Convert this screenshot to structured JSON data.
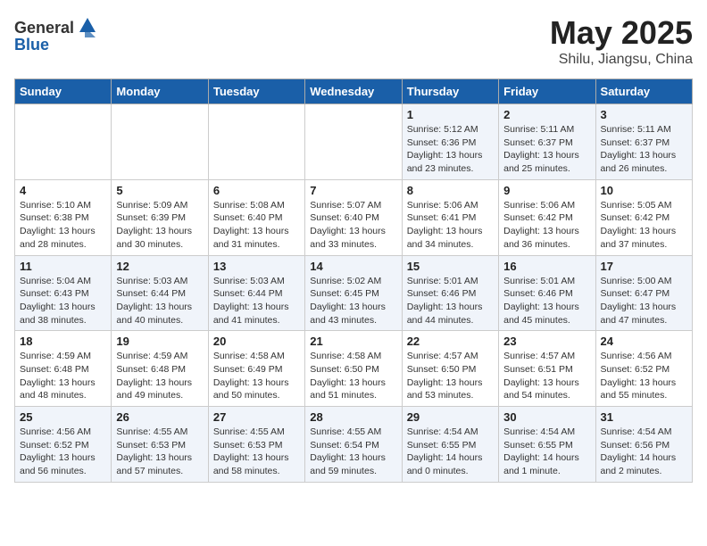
{
  "header": {
    "logo_general": "General",
    "logo_blue": "Blue",
    "month": "May 2025",
    "location": "Shilu, Jiangsu, China"
  },
  "weekdays": [
    "Sunday",
    "Monday",
    "Tuesday",
    "Wednesday",
    "Thursday",
    "Friday",
    "Saturday"
  ],
  "weeks": [
    [
      {
        "day": "",
        "info": ""
      },
      {
        "day": "",
        "info": ""
      },
      {
        "day": "",
        "info": ""
      },
      {
        "day": "",
        "info": ""
      },
      {
        "day": "1",
        "info": "Sunrise: 5:12 AM\nSunset: 6:36 PM\nDaylight: 13 hours\nand 23 minutes."
      },
      {
        "day": "2",
        "info": "Sunrise: 5:11 AM\nSunset: 6:37 PM\nDaylight: 13 hours\nand 25 minutes."
      },
      {
        "day": "3",
        "info": "Sunrise: 5:11 AM\nSunset: 6:37 PM\nDaylight: 13 hours\nand 26 minutes."
      }
    ],
    [
      {
        "day": "4",
        "info": "Sunrise: 5:10 AM\nSunset: 6:38 PM\nDaylight: 13 hours\nand 28 minutes."
      },
      {
        "day": "5",
        "info": "Sunrise: 5:09 AM\nSunset: 6:39 PM\nDaylight: 13 hours\nand 30 minutes."
      },
      {
        "day": "6",
        "info": "Sunrise: 5:08 AM\nSunset: 6:40 PM\nDaylight: 13 hours\nand 31 minutes."
      },
      {
        "day": "7",
        "info": "Sunrise: 5:07 AM\nSunset: 6:40 PM\nDaylight: 13 hours\nand 33 minutes."
      },
      {
        "day": "8",
        "info": "Sunrise: 5:06 AM\nSunset: 6:41 PM\nDaylight: 13 hours\nand 34 minutes."
      },
      {
        "day": "9",
        "info": "Sunrise: 5:06 AM\nSunset: 6:42 PM\nDaylight: 13 hours\nand 36 minutes."
      },
      {
        "day": "10",
        "info": "Sunrise: 5:05 AM\nSunset: 6:42 PM\nDaylight: 13 hours\nand 37 minutes."
      }
    ],
    [
      {
        "day": "11",
        "info": "Sunrise: 5:04 AM\nSunset: 6:43 PM\nDaylight: 13 hours\nand 38 minutes."
      },
      {
        "day": "12",
        "info": "Sunrise: 5:03 AM\nSunset: 6:44 PM\nDaylight: 13 hours\nand 40 minutes."
      },
      {
        "day": "13",
        "info": "Sunrise: 5:03 AM\nSunset: 6:44 PM\nDaylight: 13 hours\nand 41 minutes."
      },
      {
        "day": "14",
        "info": "Sunrise: 5:02 AM\nSunset: 6:45 PM\nDaylight: 13 hours\nand 43 minutes."
      },
      {
        "day": "15",
        "info": "Sunrise: 5:01 AM\nSunset: 6:46 PM\nDaylight: 13 hours\nand 44 minutes."
      },
      {
        "day": "16",
        "info": "Sunrise: 5:01 AM\nSunset: 6:46 PM\nDaylight: 13 hours\nand 45 minutes."
      },
      {
        "day": "17",
        "info": "Sunrise: 5:00 AM\nSunset: 6:47 PM\nDaylight: 13 hours\nand 47 minutes."
      }
    ],
    [
      {
        "day": "18",
        "info": "Sunrise: 4:59 AM\nSunset: 6:48 PM\nDaylight: 13 hours\nand 48 minutes."
      },
      {
        "day": "19",
        "info": "Sunrise: 4:59 AM\nSunset: 6:48 PM\nDaylight: 13 hours\nand 49 minutes."
      },
      {
        "day": "20",
        "info": "Sunrise: 4:58 AM\nSunset: 6:49 PM\nDaylight: 13 hours\nand 50 minutes."
      },
      {
        "day": "21",
        "info": "Sunrise: 4:58 AM\nSunset: 6:50 PM\nDaylight: 13 hours\nand 51 minutes."
      },
      {
        "day": "22",
        "info": "Sunrise: 4:57 AM\nSunset: 6:50 PM\nDaylight: 13 hours\nand 53 minutes."
      },
      {
        "day": "23",
        "info": "Sunrise: 4:57 AM\nSunset: 6:51 PM\nDaylight: 13 hours\nand 54 minutes."
      },
      {
        "day": "24",
        "info": "Sunrise: 4:56 AM\nSunset: 6:52 PM\nDaylight: 13 hours\nand 55 minutes."
      }
    ],
    [
      {
        "day": "25",
        "info": "Sunrise: 4:56 AM\nSunset: 6:52 PM\nDaylight: 13 hours\nand 56 minutes."
      },
      {
        "day": "26",
        "info": "Sunrise: 4:55 AM\nSunset: 6:53 PM\nDaylight: 13 hours\nand 57 minutes."
      },
      {
        "day": "27",
        "info": "Sunrise: 4:55 AM\nSunset: 6:53 PM\nDaylight: 13 hours\nand 58 minutes."
      },
      {
        "day": "28",
        "info": "Sunrise: 4:55 AM\nSunset: 6:54 PM\nDaylight: 13 hours\nand 59 minutes."
      },
      {
        "day": "29",
        "info": "Sunrise: 4:54 AM\nSunset: 6:55 PM\nDaylight: 14 hours\nand 0 minutes."
      },
      {
        "day": "30",
        "info": "Sunrise: 4:54 AM\nSunset: 6:55 PM\nDaylight: 14 hours\nand 1 minute."
      },
      {
        "day": "31",
        "info": "Sunrise: 4:54 AM\nSunset: 6:56 PM\nDaylight: 14 hours\nand 2 minutes."
      }
    ]
  ]
}
